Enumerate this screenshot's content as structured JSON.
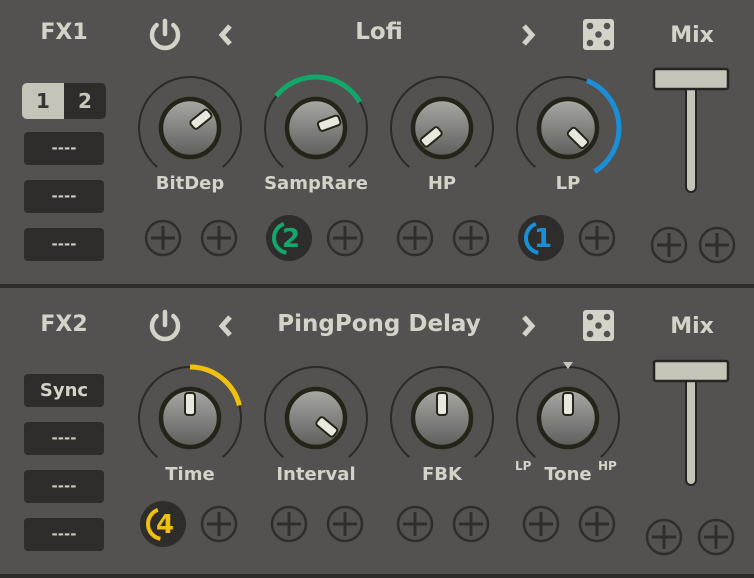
{
  "colors": {
    "green": "#12a86c",
    "blue": "#1a8fd8",
    "yellow": "#f0c010",
    "bg": "#535250",
    "dark": "#2e2d2b",
    "light": "#c4c5b8"
  },
  "fx1": {
    "label": "FX1",
    "preset": "Lofi",
    "mix_label": "Mix",
    "mix_value": 1.0,
    "page_tabs": [
      "1",
      "2"
    ],
    "active_tab": "1",
    "slots": [
      "----",
      "----",
      "----"
    ],
    "knobs": [
      {
        "label": "BitDep",
        "value": 0.69,
        "mods": [
          null,
          null
        ]
      },
      {
        "label": "SampRare",
        "value": 0.76,
        "mod_arc": [
          0.31,
          0.72
        ],
        "mod_color": "green",
        "mods": [
          "2",
          null
        ]
      },
      {
        "label": "HP",
        "value": 0.02,
        "mods": [
          null,
          null
        ]
      },
      {
        "label": "LP",
        "value": 1.0,
        "mod_arc": [
          0.58,
          1.05
        ],
        "mod_color": "blue",
        "mods": [
          "1",
          null
        ]
      }
    ]
  },
  "fx2": {
    "label": "FX2",
    "preset": "PingPong Delay",
    "mix_label": "Mix",
    "mix_value": 1.0,
    "sync_label": "Sync",
    "slots": [
      "----",
      "----",
      "----"
    ],
    "knobs": [
      {
        "label": "Time",
        "value": 0.5,
        "mod_arc": [
          0.5,
          0.78
        ],
        "mod_color": "yellow",
        "mods": [
          "4",
          null
        ]
      },
      {
        "label": "Interval",
        "value": 0.98,
        "mods": [
          null,
          null
        ]
      },
      {
        "label": "FBK",
        "value": 0.5,
        "mods": [
          null,
          null
        ]
      },
      {
        "label": "Tone",
        "value": 0.5,
        "left_label": "LP",
        "right_label": "HP",
        "center_marker": true,
        "mods": [
          null,
          null
        ]
      }
    ]
  }
}
